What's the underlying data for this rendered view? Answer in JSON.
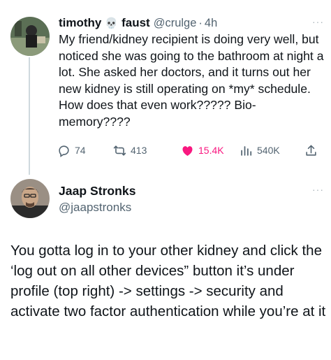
{
  "tweet": {
    "author_name": "timothy",
    "author_name_suffix": "faust",
    "emoji": "💀",
    "handle": "@crulge",
    "separator": "·",
    "time": "4h",
    "more": "···",
    "text": "My friend/kidney recipient is doing very well, but noticed she was going to the bathroom at night a lot. She asked her doctors, and it turns out her new kidney is still operating on *my* schedule. How does that even work????? Bio-memory????",
    "stats": {
      "replies": "74",
      "retweets": "413",
      "likes": "15.4K",
      "views": "540K"
    },
    "liked": true
  },
  "reply": {
    "author_name": "Jaap Stronks",
    "handle": "@jaapstronks",
    "more": "···",
    "text": "You gotta log in to your other kidney and click the ‘log out on all other devices” button it’s under profile (top right) -> settings -> security and activate two factor authentication while you’re at it"
  },
  "icons": [
    "reply-icon",
    "retweet-icon",
    "heart-icon",
    "views-icon",
    "share-icon",
    "more-icon"
  ],
  "colors": {
    "like": "#f91880",
    "secondary_text": "#536471",
    "thread_line": "#cfd9de"
  }
}
